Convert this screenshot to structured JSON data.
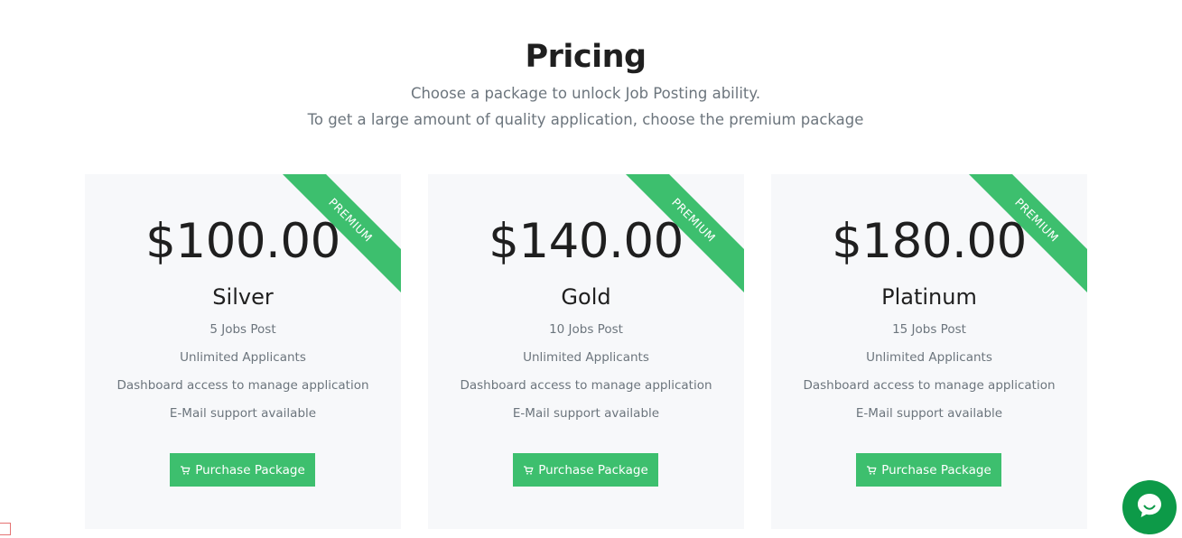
{
  "header": {
    "title": "Pricing",
    "subtitle_line1": "Choose a package to unlock Job Posting ability.",
    "subtitle_line2": "To get a large amount of quality application, choose the premium package"
  },
  "packages": [
    {
      "ribbon": "PREMIUM",
      "price": "$100.00",
      "name": "Silver",
      "features": [
        "5 Jobs Post",
        "Unlimited Applicants",
        "Dashboard access to manage application",
        "E-Mail support available"
      ],
      "button_label": "Purchase Package"
    },
    {
      "ribbon": "PREMIUM",
      "price": "$140.00",
      "name": "Gold",
      "features": [
        "10 Jobs Post",
        "Unlimited Applicants",
        "Dashboard access to manage application",
        "E-Mail support available"
      ],
      "button_label": "Purchase Package"
    },
    {
      "ribbon": "PREMIUM",
      "price": "$180.00",
      "name": "Platinum",
      "features": [
        "15 Jobs Post",
        "Unlimited Applicants",
        "Dashboard access to manage application",
        "E-Mail support available"
      ],
      "button_label": "Purchase Package"
    }
  ],
  "icons": {
    "button_icon": "cart-icon",
    "chat_icon": "chat-bubble-icon"
  },
  "colors": {
    "accent": "#3dbf6e",
    "chat": "#0d9a48",
    "card_bg": "#f7f8fa",
    "muted_text": "#6c757d"
  }
}
